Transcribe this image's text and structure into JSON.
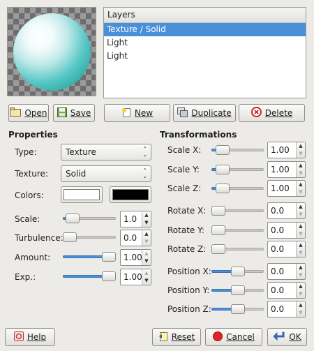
{
  "layers": {
    "header": "Layers",
    "items": [
      "Texture / Solid",
      "Light",
      "Light"
    ],
    "selected_index": 0
  },
  "buttons": {
    "open": "Open",
    "save": "Save",
    "new": "New",
    "duplicate": "Duplicate",
    "delete": "Delete",
    "help": "Help",
    "reset": "Reset",
    "cancel": "Cancel",
    "ok": "OK"
  },
  "properties": {
    "title": "Properties",
    "type_label": "Type:",
    "type_value": "Texture",
    "texture_label": "Texture:",
    "texture_value": "Solid",
    "colors_label": "Colors:",
    "color1": "#ffffff",
    "color2": "#000000",
    "scale_label": "Scale:",
    "scale_value": "1.0",
    "scale_pos": 0.08,
    "turbulence_label": "Turbulence:",
    "turbulence_value": "0.0",
    "turbulence_pos": 0.0,
    "amount_label": "Amount:",
    "amount_value": "1.00",
    "amount_pos": 1.0,
    "exp_label": "Exp.:",
    "exp_value": "1.00",
    "exp_pos": 1.0
  },
  "transformations": {
    "title": "Transformations",
    "rows": [
      {
        "label": "Scale X:",
        "value": "1.00",
        "pos": 0.1
      },
      {
        "label": "Scale Y:",
        "value": "1.00",
        "pos": 0.1
      },
      {
        "label": "Scale Z:",
        "value": "1.00",
        "pos": 0.1
      },
      {
        "label": "Rotate X:",
        "value": "0.0",
        "pos": 0.0
      },
      {
        "label": "Rotate Y:",
        "value": "0.0",
        "pos": 0.0
      },
      {
        "label": "Rotate Z:",
        "value": "0.0",
        "pos": 0.0
      },
      {
        "label": "Position X:",
        "value": "0.0",
        "pos": 0.5
      },
      {
        "label": "Position Y:",
        "value": "0.0",
        "pos": 0.5
      },
      {
        "label": "Position Z:",
        "value": "0.0",
        "pos": 0.5
      }
    ]
  },
  "colors": {
    "accent": "#4a90d9",
    "sphere": "#2aa3a2"
  }
}
